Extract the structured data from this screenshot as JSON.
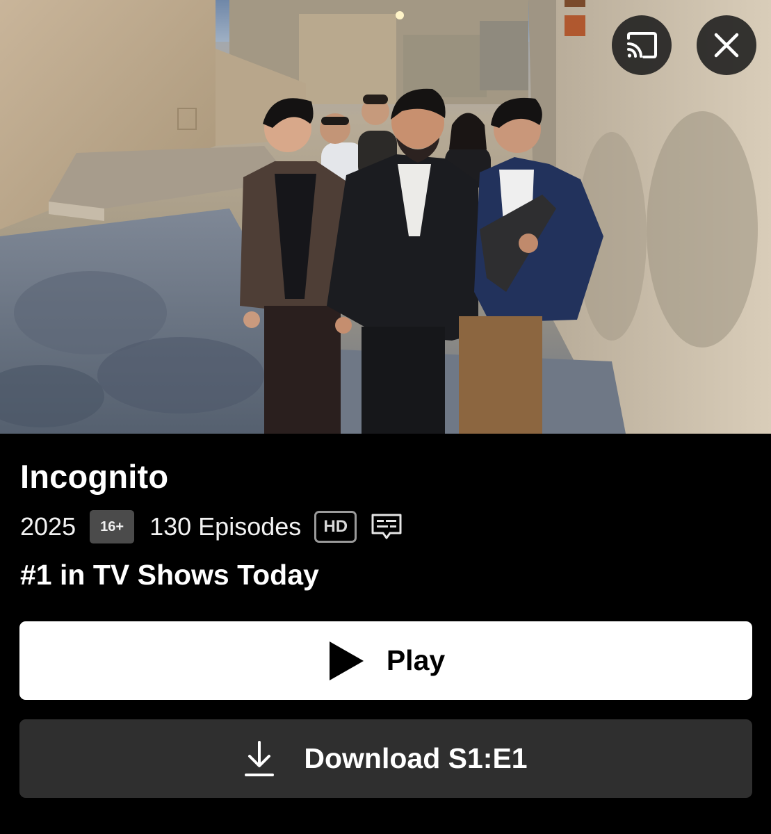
{
  "hero": {
    "image_alt": "Still from Incognito: group of people walking through stone alleyway at dusk"
  },
  "top_controls": {
    "cast_icon": "cast-icon",
    "close_icon": "close-icon"
  },
  "details": {
    "title": "Incognito",
    "year": "2025",
    "maturity_rating": "16+",
    "episodes": "130 Episodes",
    "quality_badge": "HD",
    "subtitles_icon": "subtitles-icon",
    "rank_text": "#1 in TV Shows Today"
  },
  "actions": {
    "play_label": "Play",
    "play_icon": "play-icon",
    "download_label": "Download S1:E1",
    "download_icon": "download-icon"
  },
  "colors": {
    "background": "#000000",
    "play_button": "#ffffff",
    "download_button": "#2f2f2f",
    "rating_badge": "#4b4b4b"
  }
}
